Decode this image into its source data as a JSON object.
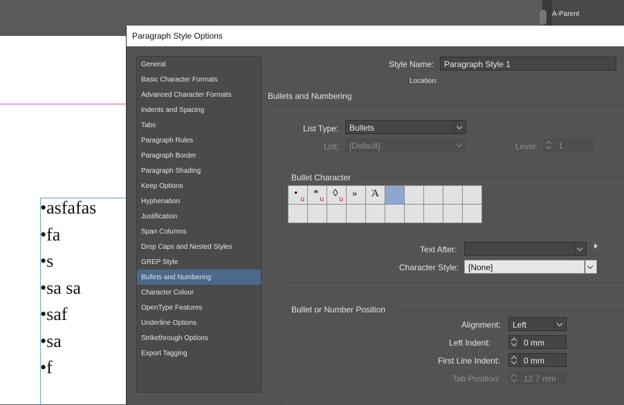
{
  "panel": {
    "label": "A-Parent"
  },
  "document": {
    "lines": [
      "•asfafas",
      "•fa",
      "•s",
      "•sa sa",
      "•saf",
      "•sa",
      "•f"
    ]
  },
  "dialog": {
    "title": "Paragraph Style Options",
    "categories": [
      "General",
      "Basic Character Formats",
      "Advanced Character Formats",
      "Indents and Spacing",
      "Tabs",
      "Paragraph Rules",
      "Paragraph Border",
      "Paragraph Shading",
      "Keep Options",
      "Hyphenation",
      "Justification",
      "Span Columns",
      "Drop Caps and Nested Styles",
      "GREP Style",
      "Bullets and Numbering",
      "Character Colour",
      "OpenType Features",
      "Underline Options",
      "Strikethrough Options",
      "Export Tagging"
    ],
    "selected_category": "Bullets and Numbering",
    "style_name_label": "Style Name:",
    "style_name_value": "Paragraph Style 1",
    "location_label": "Location:",
    "section_title": "Bullets and Numbering",
    "list_type_label": "List Type:",
    "list_type_value": "Bullets",
    "list_label": "List:",
    "list_value": "[Default]",
    "level_label": "Level:",
    "level_value": "1",
    "bullet_character_title": "Bullet Character",
    "bullet_glyphs": [
      {
        "glyph": "•",
        "mark": "u"
      },
      {
        "glyph": "*",
        "mark": "u"
      },
      {
        "glyph": "◊",
        "mark": "u"
      },
      {
        "glyph": "»",
        "mark": ""
      },
      {
        "glyph": "Ά",
        "mark": ""
      }
    ],
    "text_after_label": "Text After:",
    "text_after_value": "",
    "character_style_label": "Character Style:",
    "character_style_value": "[None]",
    "position_title": "Bullet or Number Position",
    "alignment_label": "Alignment:",
    "alignment_value": "Left",
    "left_indent_label": "Left Indent:",
    "left_indent_value": "0 mm",
    "first_line_indent_label": "First Line Indent:",
    "first_line_indent_value": "0 mm",
    "tab_position_label": "Tab Position:",
    "tab_position_value": "12.7 mm"
  },
  "colors": {
    "selection": "#4b6a8a",
    "dialog_bg": "#535353",
    "glyph_selected": "#8ea7d0",
    "underline_mark": "#d01010"
  }
}
